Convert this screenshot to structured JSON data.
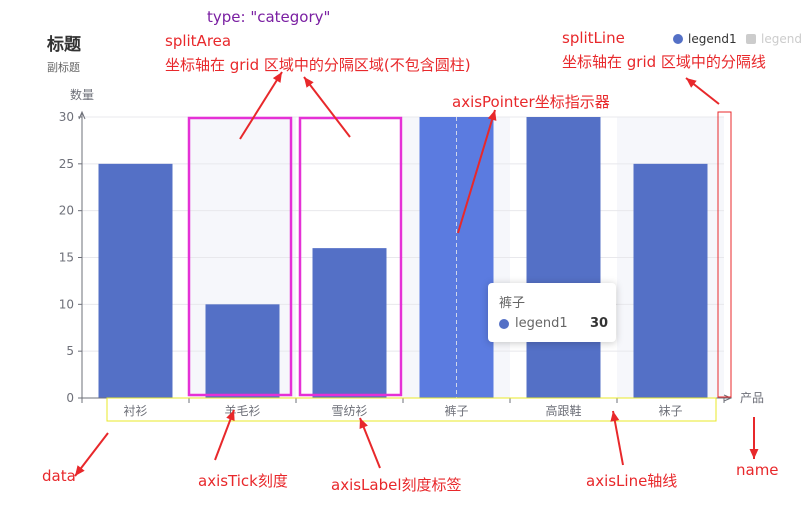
{
  "title": "标题",
  "subtitle": "副标题",
  "legend": {
    "items": [
      {
        "name": "legend1",
        "active": true
      },
      {
        "name": "legend",
        "active": false
      }
    ]
  },
  "tooltip": {
    "title": "裤子",
    "series": "legend1",
    "value": "30"
  },
  "annotations": {
    "type_category": "type: \"category\"",
    "split_area_title": "splitArea",
    "split_area_desc": "坐标轴在 grid 区域中的分隔区域(不包含圆柱)",
    "split_line_title": "splitLine",
    "split_line_desc": "坐标轴在 grid 区域中的分隔线",
    "axis_pointer": "axisPointer坐标指示器",
    "data": "data",
    "axis_tick": "axisTick刻度",
    "axis_label": "axisLabel刻度标签",
    "axis_line": "axisLine轴线",
    "name": "name"
  },
  "colors": {
    "bar": "#5470c6",
    "bar_highlight": "#5b7be0",
    "annotation_red": "#e8282b",
    "annotation_magenta": "#e531d6",
    "annotation_purple": "#7a1fa2",
    "annotation_yellow": "#e8e82a",
    "split_area": "#f6f7fb",
    "legend_off": "#cccccc"
  },
  "chart_data": {
    "type": "bar",
    "title": "标题",
    "subtitle": "副标题",
    "categories": [
      "衬衫",
      "羊毛衫",
      "雪纺衫",
      "裤子",
      "高跟鞋",
      "袜子"
    ],
    "series": [
      {
        "name": "legend1",
        "values": [
          25,
          10,
          16,
          30,
          30,
          25
        ]
      }
    ],
    "xlabel": "产品",
    "ylabel": "数量",
    "ylim": [
      0,
      30
    ],
    "yticks": [
      0,
      5,
      10,
      15,
      20,
      25,
      30
    ],
    "grid": true,
    "legend": "top-right",
    "highlighted_category": "裤子"
  }
}
